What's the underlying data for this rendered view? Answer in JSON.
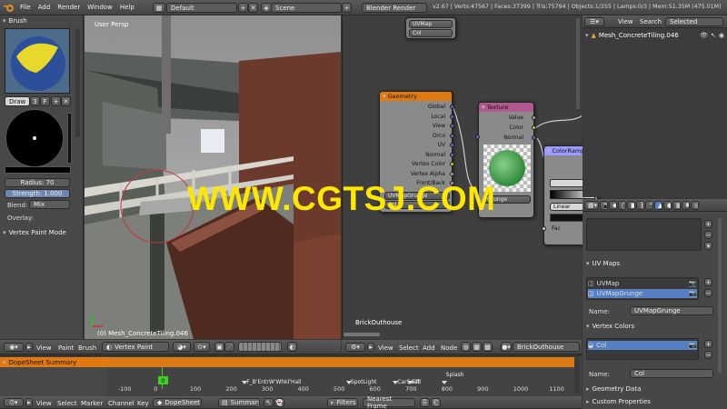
{
  "topbar": {
    "menus": [
      "File",
      "Add",
      "Render",
      "Window",
      "Help"
    ],
    "layout": "Default",
    "scene": "Scene",
    "engine": "Blender Render",
    "stats": "v2.67 | Verts:47567 | Faces:37399 | Tris:75794 | Objects:1/255 | Lamps:0/3 | Mem:51.35M (475.01M)"
  },
  "toolshelf": {
    "brush_title": "Brush",
    "draw_label": "Draw",
    "draw_count": "3",
    "f_label": "F",
    "radius_label": "Radius: 70",
    "strength_label": "Strength: 1.000",
    "blend_label": "Blend:",
    "blend_value": "Mix",
    "overlay_label": "Overlay:",
    "vertex_paint_mode": "Vertex Paint Mode"
  },
  "viewport": {
    "view_label": "User Persp",
    "object_label": "(0) Mesh_ConcreteTiling.046",
    "header_menus": [
      "View",
      "Paint",
      "Brush"
    ],
    "mode": "Vertex Paint"
  },
  "node_editor": {
    "uvmap_node": {
      "sockets": [
        "UVMap",
        "Col"
      ]
    },
    "geometry_node": {
      "title": "Geometry",
      "outputs": [
        "Global",
        "Local",
        "View",
        "Orco",
        "UV",
        "Normal",
        "Vertex Color",
        "Vertex Alpha",
        "Front/Back"
      ],
      "fields": [
        "UVMapGrunge",
        "Col"
      ]
    },
    "texture_node": {
      "title": "Texture",
      "outputs": [
        "Value",
        "Color",
        "Normal"
      ],
      "field": "Grunge"
    },
    "color_node": {
      "title": "ColorRamp",
      "interp": "Linear",
      "fac_label": "Fac"
    },
    "material_name": "BrickOuthouse",
    "header_menus": [
      "View",
      "Select",
      "Add",
      "Node"
    ],
    "material_field": "BrickOuthouse"
  },
  "watermark": "WWW.CGTSJ.COM",
  "outliner": {
    "header_menus": [
      "View",
      "Search"
    ],
    "filter": "Selected",
    "item": "Mesh_ConcreteTiling.046"
  },
  "properties": {
    "uvmaps_title": "UV Maps",
    "uvmaps": [
      "UVMap",
      "UVMapGrunge"
    ],
    "uv_name_label": "Name:",
    "uv_name_value": "UVMapGrunge",
    "vcol_title": "Vertex Colors",
    "vcols": [
      "Col"
    ],
    "vcol_name_label": "Name:",
    "vcol_name_value": "Col",
    "geometry_data_title": "Geometry Data",
    "custom_props_title": "Custom Properties"
  },
  "dopesheet": {
    "summary": "DopeSheet Summary",
    "frame": "0",
    "ticks": [
      "-100",
      "0",
      "100",
      "200",
      "300",
      "400",
      "500",
      "600",
      "700",
      "800",
      "900",
      "1000",
      "1100"
    ],
    "markers": [
      {
        "label": "F_B'EntrW'Whkl'Hall",
        "frame": 230
      },
      {
        "label": "SpotLight",
        "frame": 520
      },
      {
        "label": "CarSwift",
        "frame": 650
      },
      {
        "label": "Fall",
        "frame": 690
      },
      {
        "label": "Splash",
        "frame": 785
      }
    ],
    "header_menus": [
      "View",
      "Select",
      "Marker",
      "Channel",
      "Key"
    ],
    "mode": "DopeSheet",
    "summary_btn": "Summary",
    "filters_btn": "Filters",
    "snap": "Nearest Frame"
  },
  "colors": {
    "accent_orange": "#e07a10",
    "selected_blue": "#5680c2",
    "watermark_yellow": "#ffe800",
    "frame_green": "#41d01c"
  }
}
